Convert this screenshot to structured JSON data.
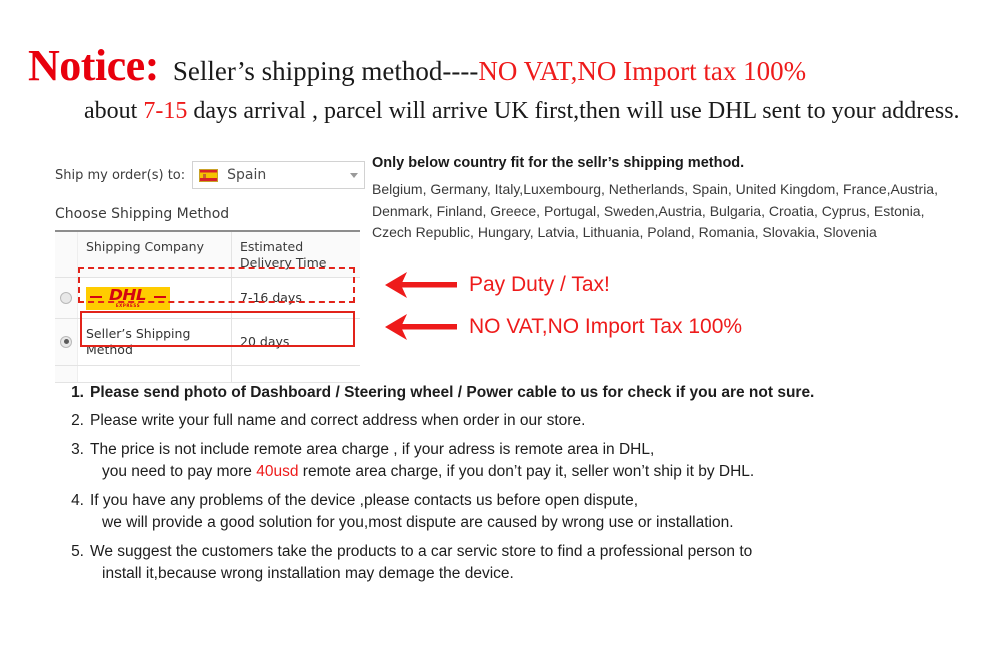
{
  "header": {
    "notice_word": "Notice:",
    "line1_black": "Seller’s  shipping method----",
    "line1_red": "NO VAT,NO Import tax 100%",
    "line2_pre": "about ",
    "line2_red": "7-15",
    "line2_post": " days arrival , parcel will arrive UK first,then will use DHL sent to your address."
  },
  "widget": {
    "ship_to_label": "Ship my order(s) to:",
    "country_value": "Spain",
    "country_flag_icon": "flag-spain-icon",
    "dropdown_caret_icon": "chevron-down-icon",
    "choose_shipping_label": "Choose Shipping Method",
    "table": {
      "columns": [
        "Shipping Company",
        "Estimated Delivery Time"
      ],
      "rows": [
        {
          "company": "DHL",
          "company_type": "logo",
          "logo_text": "DHL",
          "logo_subtext": "EXPRESS",
          "time": "7-16 days",
          "selected": false
        },
        {
          "company": "Seller’s Shipping Method",
          "company_type": "text",
          "time": "20 days",
          "selected": true
        }
      ]
    }
  },
  "callouts": [
    {
      "text": "Pay Duty / Tax!"
    },
    {
      "text": "NO VAT,NO Import Tax 100%"
    }
  ],
  "countries": {
    "title": "Only below country fit for the sellr’s shipping method.",
    "lines": [
      "Belgium, Germany, Italy,Luxembourg, Netherlands, Spain, United Kingdom, France,Austria,",
      "Denmark, Finland, Greece, Portugal, Sweden,Austria, Bulgaria, Croatia, Cyprus, Estonia,",
      "Czech Republic, Hungary, Latvia, Lithuania, Poland, Romania, Slovakia, Slovenia"
    ]
  },
  "notes": [
    {
      "num": "1.",
      "bold": true,
      "lines": [
        {
          "text": "Please send photo of Dashboard / Steering wheel / Power cable to us for check if you are not sure."
        }
      ]
    },
    {
      "num": "2.",
      "bold": false,
      "lines": [
        {
          "text": "Please write your full name and correct address when order in our store."
        }
      ]
    },
    {
      "num": "3.",
      "bold": false,
      "lines": [
        {
          "text": "The price is not include remote area charge , if your adress is remote area in DHL,"
        },
        {
          "pre": "you need to pay more ",
          "red": "40usd",
          "post": " remote area charge, if you don’t pay it, seller won’t ship it by DHL.",
          "indent": true
        }
      ]
    },
    {
      "num": "4.",
      "bold": false,
      "lines": [
        {
          "text": "If you have any problems of the device ,please contacts us before open dispute,"
        },
        {
          "text": "we will provide a good solution for you,most dispute are caused by wrong use or installation.",
          "indent": true
        }
      ]
    },
    {
      "num": "5.",
      "bold": false,
      "lines": [
        {
          "text": "We suggest the customers take the products to a car servic store to find a professional person to"
        },
        {
          "text": "install it,because wrong installation may demage the device.",
          "indent": true
        }
      ]
    }
  ],
  "colors": {
    "red": "#ee1b1b",
    "notice_red": "#e8000d",
    "highlight_red": "#e2231a",
    "dhl_yellow": "#ffcc00",
    "dhl_red": "#d40511"
  }
}
